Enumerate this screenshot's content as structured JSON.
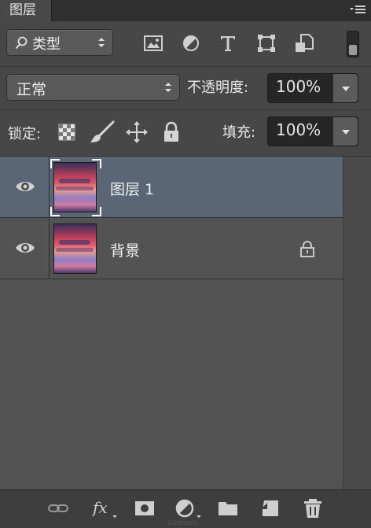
{
  "panel": {
    "tab_label": "图层",
    "menu_icon": "panel-menu-icon"
  },
  "filter": {
    "search_icon": "search-icon",
    "kind_value": "类型",
    "icons": [
      "pixel-layer-filter-icon",
      "adjustment-layer-filter-icon",
      "type-layer-filter-icon",
      "shape-layer-filter-icon",
      "smart-object-filter-icon"
    ],
    "toggle_icon": "filter-toggle-icon"
  },
  "blend": {
    "mode_value": "正常",
    "opacity_label": "不透明度:",
    "opacity_value": "100%"
  },
  "lock": {
    "label": "锁定:",
    "icons": [
      "lock-transparent-pixels-icon",
      "lock-image-pixels-icon",
      "lock-position-icon",
      "lock-all-icon"
    ],
    "fill_label": "填充:",
    "fill_value": "100%"
  },
  "layers": [
    {
      "name": "图层 1",
      "selected": true,
      "visible_icon": "eye-icon",
      "locked": false
    },
    {
      "name": "背景",
      "selected": false,
      "visible_icon": "eye-icon",
      "locked": true
    }
  ],
  "bottom_bar": {
    "icons": [
      "link-layers-icon",
      "layer-style-fx-icon",
      "add-mask-icon",
      "new-adjustment-layer-icon",
      "new-group-folder-icon",
      "new-layer-icon",
      "delete-layer-trash-icon"
    ]
  },
  "colors": {
    "selected_row": "#5a6575",
    "panel_bg": "#535353"
  }
}
